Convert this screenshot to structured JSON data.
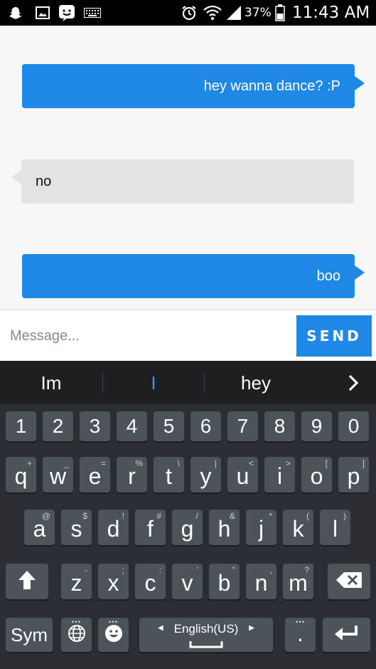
{
  "status_bar": {
    "battery_percent": "37%",
    "time": "11:43 AM",
    "icons": [
      "snapchat-icon",
      "gallery-icon",
      "messenger-icon",
      "keyboard-icon",
      "alarm-icon",
      "wifi-icon",
      "signal-icon",
      "battery-icon"
    ]
  },
  "chat": {
    "messages": [
      {
        "direction": "outgoing",
        "text": "hey wanna dance? :P"
      },
      {
        "direction": "incoming",
        "text": "no"
      },
      {
        "direction": "outgoing",
        "text": "boo"
      }
    ]
  },
  "composer": {
    "placeholder": "Message...",
    "send_label": "SEND"
  },
  "suggestions": {
    "items": [
      "Im",
      "I",
      "hey"
    ],
    "highlight_color": "#4a90e2",
    "more_icon": "chevron-right-icon"
  },
  "keyboard": {
    "number_row": [
      "1",
      "2",
      "3",
      "4",
      "5",
      "6",
      "7",
      "8",
      "9",
      "0"
    ],
    "row1": [
      {
        "key": "q",
        "alt": "+"
      },
      {
        "key": "w",
        "alt": "_"
      },
      {
        "key": "e",
        "alt": "="
      },
      {
        "key": "r",
        "alt": "%"
      },
      {
        "key": "t",
        "alt": "\\"
      },
      {
        "key": "y",
        "alt": "|"
      },
      {
        "key": "u",
        "alt": "<"
      },
      {
        "key": "i",
        "alt": ">"
      },
      {
        "key": "o",
        "alt": "["
      },
      {
        "key": "p",
        "alt": "]"
      }
    ],
    "row2": [
      {
        "key": "a",
        "alt": "@"
      },
      {
        "key": "s",
        "alt": "$"
      },
      {
        "key": "d",
        "alt": "!"
      },
      {
        "key": "f",
        "alt": "#"
      },
      {
        "key": "g",
        "alt": "/"
      },
      {
        "key": "h",
        "alt": "&"
      },
      {
        "key": "j",
        "alt": "*"
      },
      {
        "key": "k",
        "alt": "("
      },
      {
        "key": "l",
        "alt": ")"
      }
    ],
    "row3": [
      {
        "key": "z",
        "alt": "-"
      },
      {
        "key": "x",
        "alt": ";"
      },
      {
        "key": "c",
        "alt": ":"
      },
      {
        "key": "v",
        "alt": "'"
      },
      {
        "key": "b",
        "alt": "\""
      },
      {
        "key": "n",
        "alt": ","
      },
      {
        "key": "m",
        "alt": "?"
      }
    ],
    "sym_label": "Sym",
    "language_label": "English(US)",
    "period_label": ".",
    "icons": [
      "shift-icon",
      "backspace-icon",
      "globe-icon",
      "emoji-icon",
      "space-icon",
      "enter-icon"
    ]
  },
  "colors": {
    "accent": "#1e88e5",
    "incoming_bubble": "#e3e2e4",
    "keyboard_bg": "#2a2e33",
    "key_bg": "#4c5359"
  }
}
